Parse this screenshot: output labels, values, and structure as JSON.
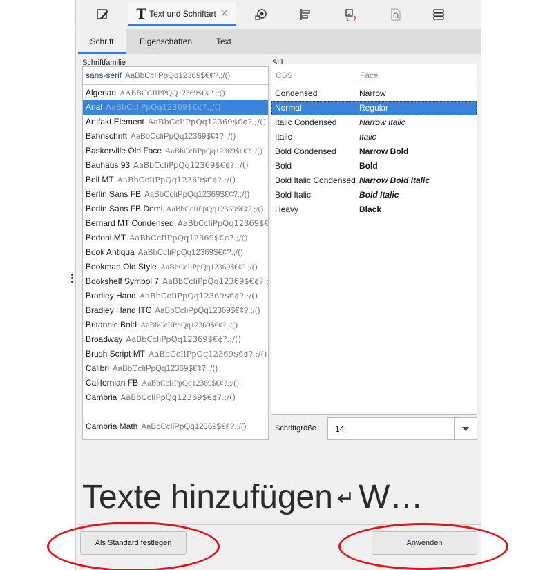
{
  "toolbar": {
    "active_tab_label": "Text und Schriftart",
    "active_tab_icon": "text-T-icon",
    "close_glyph": "✕",
    "icons": [
      "fill-stroke-icon",
      "text-font-icon",
      "object-properties-icon",
      "align-distribute-icon",
      "transform-icon",
      "document-properties-icon",
      "layers-icon"
    ]
  },
  "subtabs": [
    "Schrift",
    "Eigenschaften",
    "Text"
  ],
  "font_family": {
    "label": "Schriftfamilie",
    "first": {
      "name": "sans-serif",
      "sample": "AaBbCcIiPpQq12369$€¢?.;/()"
    },
    "items": [
      {
        "name": "Algerian",
        "sample": "AABBCCIIPPQQ12369$€¢?.;/()"
      },
      {
        "name": "Arial",
        "sample": "AaBbCcIiPpQq12369$€¢?.;/()",
        "selected": true
      },
      {
        "name": "Artifakt Element",
        "sample": "AaBbCcIiPpQq12369$€¢?.;/()"
      },
      {
        "name": "Bahnschrift",
        "sample": "AaBbCcIiPpQq12369$€¢?.;/()"
      },
      {
        "name": "Baskerville Old Face",
        "sample": "AaBbCcIiPpQq12369$€¢?.;/()"
      },
      {
        "name": "Bauhaus 93",
        "sample": "AaBbCcIiPpQq12369$€¢?.;/()"
      },
      {
        "name": "Bell MT",
        "sample": "AaBbCcIiPpQq12369$€¢?.;/()"
      },
      {
        "name": "Berlin Sans FB",
        "sample": "AaBbCcIiPpQq12369$€¢?.;/()"
      },
      {
        "name": "Berlin Sans FB Demi",
        "sample": "AaBbCcIiPpQq12369$€¢?.;/()"
      },
      {
        "name": "Bernard MT Condensed",
        "sample": "AaBbCcIiPpQq12369$€¢?.;/()"
      },
      {
        "name": "Bodoni MT",
        "sample": "AaBbCcIiPpQq12369$€¢?.;/()"
      },
      {
        "name": "Book Antiqua",
        "sample": "AaBbCcIiPpQq12369$€¢?.;/()"
      },
      {
        "name": "Bookman Old Style",
        "sample": "AaBbCcIiPpQq12369$€¢?.;/()"
      },
      {
        "name": "Bookshelf Symbol 7",
        "sample": "AaBbCcIiPpQq12369$€¢?.;/()"
      },
      {
        "name": "Bradley Hand",
        "sample": "AaBbCcIiPpQq12369$€¢?.;/()"
      },
      {
        "name": "Bradley Hand ITC",
        "sample": "AaBbCcIiPpQq12369$€¢?.;/()"
      },
      {
        "name": "Britannic Bold",
        "sample": "AaBbCcIiPpQq12369$€¢?.;/()"
      },
      {
        "name": "Broadway",
        "sample": "AaBbCcIiPpQq12369$€¢?.;/()"
      },
      {
        "name": "Brush Script MT",
        "sample": "AaBbCcIiPpQq12369$€¢?.;/()"
      },
      {
        "name": "Calibri",
        "sample": "AaBbCcIiPpQq12369$€¢?.;/()"
      },
      {
        "name": "Californian FB",
        "sample": "AaBbCcIiPpQq12369$€¢?.;/()"
      },
      {
        "name": "Cambria",
        "sample": "AaBbCcIiPpQq12369$€¢?.;/()"
      },
      {
        "name": "",
        "sample": ""
      },
      {
        "name": "Cambria Math",
        "sample": "AaBbCcIiPpQq12369$€¢?.;/()"
      }
    ]
  },
  "style": {
    "label": "Stil",
    "col_css": "CSS",
    "col_face": "Face",
    "rows": [
      {
        "css": "Condensed",
        "face": "Narrow",
        "weight": "normal",
        "italic": false
      },
      {
        "css": "Normal",
        "face": "Regular",
        "weight": "normal",
        "italic": false,
        "selected": true
      },
      {
        "css": "Italic Condensed",
        "face": "Narrow Italic",
        "weight": "normal",
        "italic": true
      },
      {
        "css": "Italic",
        "face": "Italic",
        "weight": "normal",
        "italic": true
      },
      {
        "css": "Bold Condensed",
        "face": "Narrow Bold",
        "weight": "bold",
        "italic": false
      },
      {
        "css": "Bold",
        "face": "Bold",
        "weight": "bold",
        "italic": false
      },
      {
        "css": "Bold Italic Condensed",
        "face": "Narrow Bold Italic",
        "weight": "bold",
        "italic": true
      },
      {
        "css": "Bold Italic",
        "face": "Bold Italic",
        "weight": "bold",
        "italic": true
      },
      {
        "css": "Heavy",
        "face": "Black",
        "weight": "bold",
        "italic": false
      }
    ]
  },
  "font_size": {
    "label": "Schriftgröße",
    "value": "14"
  },
  "preview": {
    "text_before": "Texte hinzufügen",
    "return_glyph": "↵",
    "text_after": "W…"
  },
  "buttons": {
    "set_default": "Als Standard festlegen",
    "apply": "Anwenden"
  },
  "colors": {
    "accent": "#2f7ed8",
    "selection": "#3b83d9",
    "marker": "#e0141b"
  }
}
